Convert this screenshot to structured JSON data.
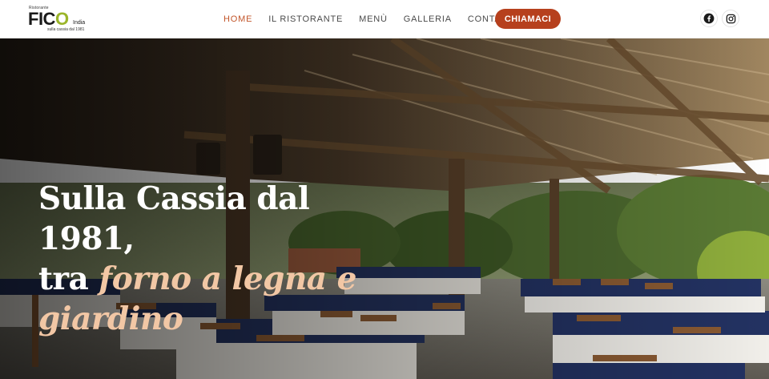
{
  "logo": {
    "top_text": "Ristorante",
    "name_a": "FIC",
    "name_b": "O",
    "suffix": "India",
    "tagline": "sulla cassia dal 1981"
  },
  "nav": {
    "items": [
      {
        "label": "HOME",
        "active": true
      },
      {
        "label": "IL RISTORANTE",
        "active": false
      },
      {
        "label": "MENÙ",
        "active": false
      },
      {
        "label": "GALLERIA",
        "active": false
      },
      {
        "label": "CONTATTI",
        "active": false
      }
    ],
    "cta_label": "CHIAMACI"
  },
  "social": {
    "icons": [
      "facebook-icon",
      "instagram-icon"
    ]
  },
  "hero": {
    "line1": "Sulla Cassia dal 1981,",
    "line2_plain": "tra ",
    "line2_accent": "forno a legna e",
    "line3_accent": "giardino"
  },
  "colors": {
    "accent": "#c2552a",
    "cta": "#b6401d",
    "headline_accent": "#f2c7a5",
    "logo_green": "#9bb52a"
  }
}
